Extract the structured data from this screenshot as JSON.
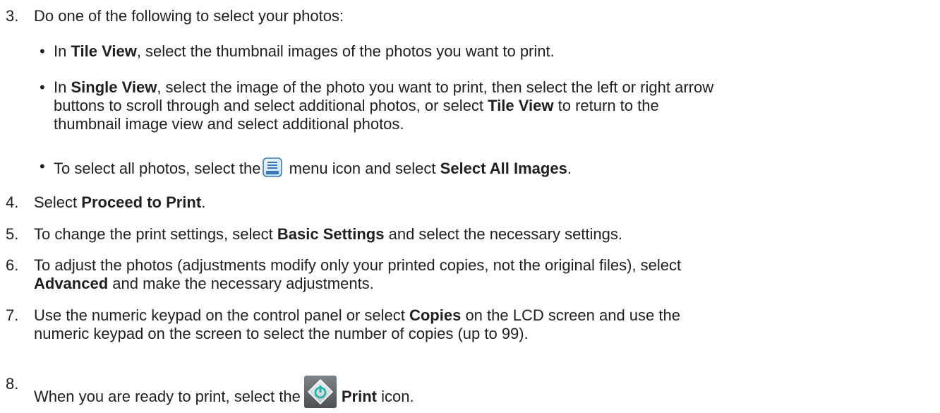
{
  "steps": {
    "s3": {
      "num": "3.",
      "text": "Do one of the following to select your photos:"
    },
    "b1": {
      "pre": "In ",
      "bold1": "Tile View",
      "post": ", select the thumbnail images of the photos you want to print."
    },
    "b2": {
      "pre": "In ",
      "bold1": "Single View",
      "line1_rest": ", select the image of the photo you want to print, then select the left or right arrow",
      "line2_pre": "buttons to scroll through and select additional photos, or select ",
      "bold2": "Tile View",
      "line2_post": " to return to the",
      "line3": "thumbnail image view and select additional photos."
    },
    "b3": {
      "pre": "To select all photos, select the",
      "mid": " menu icon and select ",
      "bold1": "Select All Images",
      "post": "."
    },
    "s4": {
      "num": "4.",
      "pre": "Select ",
      "bold1": "Proceed to Print",
      "post": "."
    },
    "s5": {
      "num": "5.",
      "pre": "To change the print settings, select ",
      "bold1": "Basic Settings",
      "post": " and select the necessary settings."
    },
    "s6": {
      "num": "6.",
      "line1": "To adjust the photos (adjustments modify only your printed copies, not the original files), select",
      "bold1": "Advanced",
      "line2_post": " and make the necessary adjustments."
    },
    "s7": {
      "num": "7.",
      "pre": "Use the numeric keypad on the control panel or select ",
      "bold1": "Copies",
      "line1_post": " on the LCD screen and use the",
      "line2": "numeric keypad on the screen to select the number of copies (up to 99)."
    },
    "s8": {
      "num": "8.",
      "pre": "When you are ready to print, select the",
      "bold1": "Print",
      "post": " icon."
    },
    "bullet_char": "•"
  },
  "icons": {
    "menu": "menu-icon",
    "print": "print-start-icon"
  }
}
